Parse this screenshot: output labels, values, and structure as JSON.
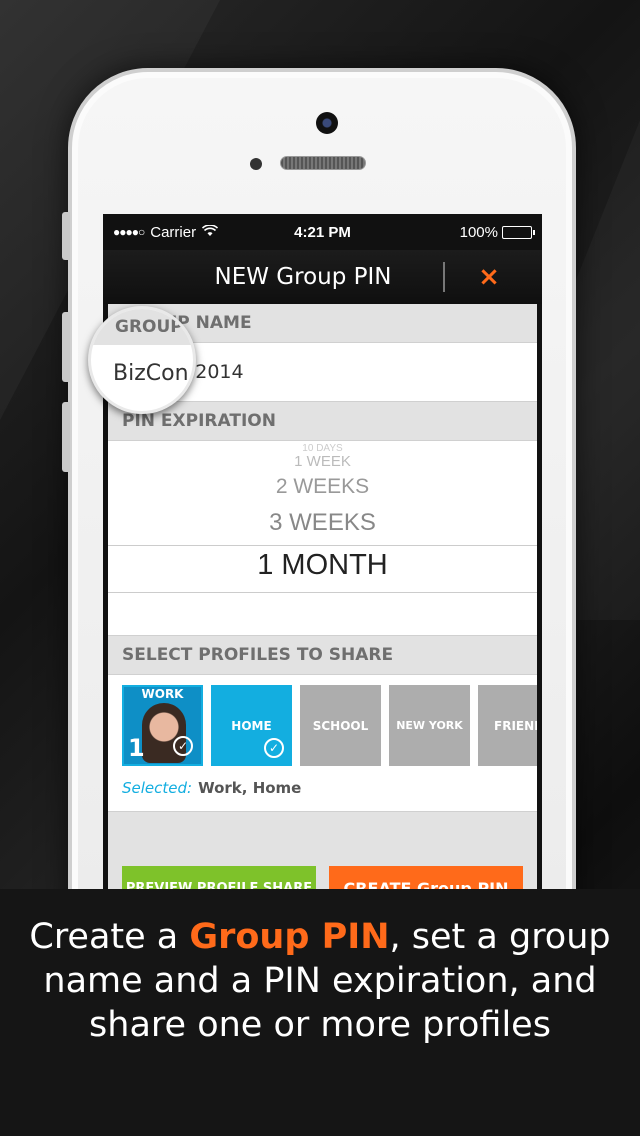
{
  "status_bar": {
    "signal": "●●●●○",
    "carrier": "Carrier",
    "time": "4:21 PM",
    "battery": "100%"
  },
  "nav": {
    "title": "NEW Group PIN",
    "close": "×"
  },
  "group_name": {
    "header": "GROUP NAME",
    "value": "BizCon 2014",
    "magnified_header": "GROUP",
    "magnified_text": "BizCon"
  },
  "pin_expiration": {
    "header": "PIN EXPIRATION",
    "options": [
      "10 DAYS",
      "1 WEEK",
      "2 WEEKS",
      "3 WEEKS",
      "1 MONTH"
    ],
    "selected": "1 MONTH"
  },
  "profiles": {
    "header": "SELECT PROFILES TO SHARE",
    "tiles": [
      {
        "label": "WORK",
        "badge": "1",
        "selected": true
      },
      {
        "label": "HOME",
        "selected": true
      },
      {
        "label": "SCHOOL",
        "selected": false
      },
      {
        "label": "NEW YORK",
        "selected": false
      },
      {
        "label": "FRIENDS",
        "selected": false
      }
    ],
    "selected_label": "Selected:",
    "selected_value": "Work, Home"
  },
  "actions": {
    "preview": "PREVIEW PROFILE SHARE",
    "create": "CREATE Group PIN"
  },
  "caption": {
    "line1_before": "Create a ",
    "line1_accent": "Group PIN",
    "line1_after": ", set a group",
    "line2": "name and a PIN expiration, and",
    "line3": "share one or more profiles"
  },
  "colors": {
    "accent": "#ff6a1a",
    "blue": "#13aee0",
    "green": "#7ec22a",
    "grey_tile": "#adadad"
  }
}
